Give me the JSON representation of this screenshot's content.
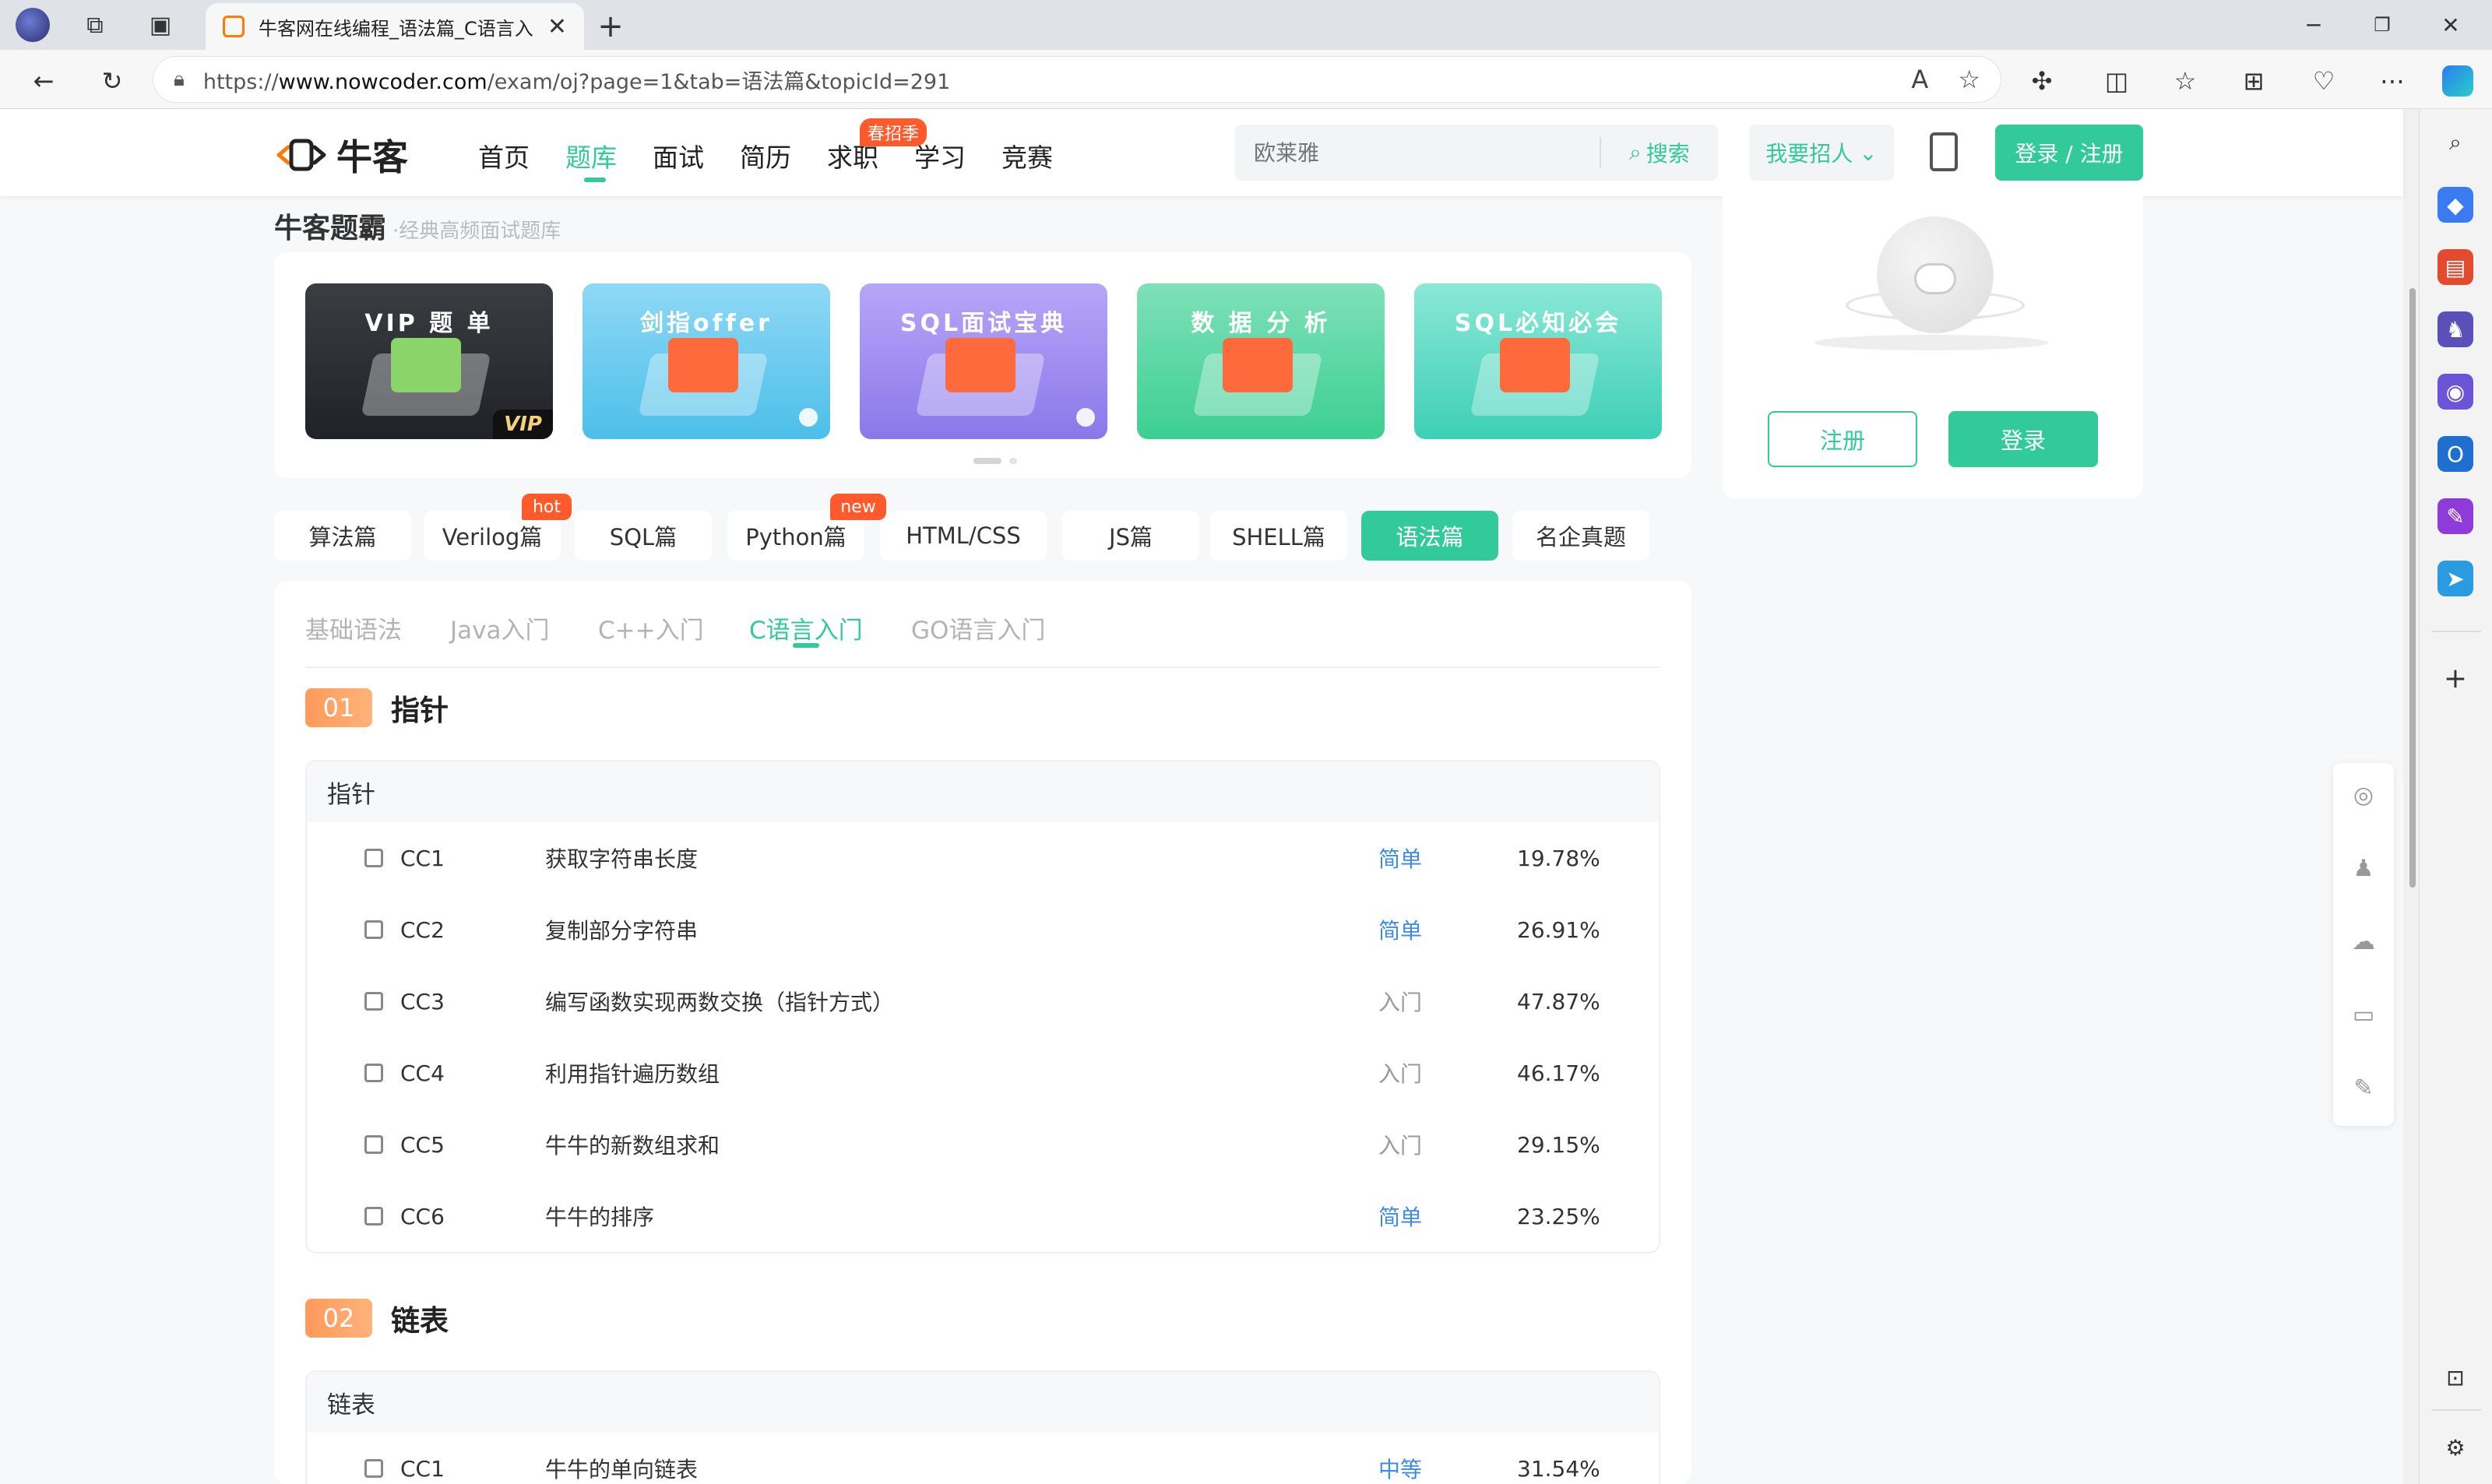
{
  "browser": {
    "tab_title": "牛客网在线编程_语法篇_C语言入",
    "url_prefix": "https://",
    "url_domain": "www.nowcoder.com",
    "url_path": "/exam/oj?page=1&tab=语法篇&topicId=291",
    "win_minimize": "─",
    "win_maximize": "❐",
    "win_close": "✕",
    "new_tab": "+"
  },
  "header": {
    "logo_text": "牛客",
    "nav": [
      "首页",
      "题库",
      "面试",
      "简历",
      "求职",
      "学习",
      "竞赛"
    ],
    "nav_badge": "春招季",
    "search_placeholder": "欧莱雅",
    "search_button": "搜索",
    "recruit": "我要招人",
    "login": "登录 / 注册"
  },
  "section": {
    "title": "牛客题霸",
    "subtitle": "经典高频面试题库"
  },
  "banners": [
    {
      "label": "VIP 题 单",
      "color_a": "#3a3d42",
      "color_b": "#1f2226",
      "tag": "VIP"
    },
    {
      "label": "剑指offer",
      "color_a": "#8fd8f5",
      "color_b": "#4cbfe9",
      "tag": ""
    },
    {
      "label": "SQL面试宝典",
      "color_a": "#b7a6f7",
      "color_b": "#8a78ea",
      "tag": ""
    },
    {
      "label": "数 据 分 析",
      "color_a": "#7fe0b8",
      "color_b": "#3ccf92",
      "tag": ""
    },
    {
      "label": "SQL必知必会",
      "color_a": "#8ae8d6",
      "color_b": "#3dcfb7",
      "tag": ""
    }
  ],
  "categories": [
    "算法篇",
    "Verilog篇",
    "SQL篇",
    "Python篇",
    "HTML/CSS",
    "JS篇",
    "SHELL篇",
    "语法篇",
    "名企真题"
  ],
  "category_badges": {
    "hot": "hot",
    "new": "new"
  },
  "sub_tabs": [
    "基础语法",
    "Java入门",
    "C++入门",
    "C语言入门",
    "GO语言入门"
  ],
  "chapters": [
    {
      "num": "01",
      "title": "指针",
      "group": "指针",
      "questions": [
        {
          "id": "CC1",
          "name": "获取字符串长度",
          "difficulty": "简单",
          "rate": "19.78%"
        },
        {
          "id": "CC2",
          "name": "复制部分字符串",
          "difficulty": "简单",
          "rate": "26.91%"
        },
        {
          "id": "CC3",
          "name": "编写函数实现两数交换（指针方式）",
          "difficulty": "入门",
          "rate": "47.87%"
        },
        {
          "id": "CC4",
          "name": "利用指针遍历数组",
          "difficulty": "入门",
          "rate": "46.17%"
        },
        {
          "id": "CC5",
          "name": "牛牛的新数组求和",
          "difficulty": "入门",
          "rate": "29.15%"
        },
        {
          "id": "CC6",
          "name": "牛牛的排序",
          "difficulty": "简单",
          "rate": "23.25%"
        }
      ]
    },
    {
      "num": "02",
      "title": "链表",
      "group": "链表",
      "questions": [
        {
          "id": "CC1",
          "name": "牛牛的单向链表",
          "difficulty": "中等",
          "rate": "31.54%"
        }
      ]
    }
  ],
  "login_card": {
    "register": "注册",
    "login": "登录"
  },
  "colors": {
    "accent": "#32ca99",
    "easy": "#3c8ce7",
    "hot_badge": "#ff5a2b"
  }
}
